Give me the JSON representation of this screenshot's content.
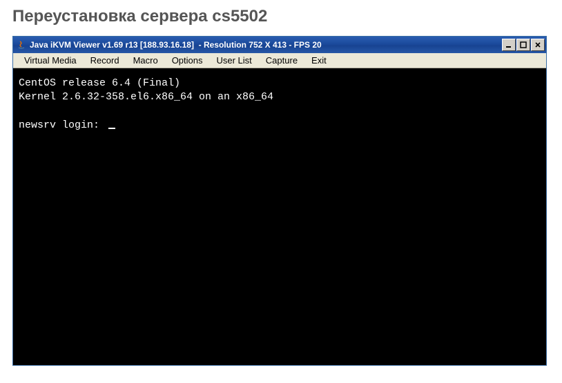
{
  "page": {
    "heading": "Переустановка сервера cs5502"
  },
  "window": {
    "title": "Java iKVM Viewer v1.69 r13 [188.93.16.18]  - Resolution 752 X 413 - FPS 20",
    "controls": {
      "minimize": "_",
      "maximize": "□",
      "close": "✕"
    }
  },
  "menubar": {
    "items": [
      "Virtual Media",
      "Record",
      "Macro",
      "Options",
      "User List",
      "Capture",
      "Exit"
    ]
  },
  "terminal": {
    "line1": "CentOS release 6.4 (Final)",
    "line2": "Kernel 2.6.32-358.el6.x86_64 on an x86_64",
    "line3": "",
    "prompt": "newsrv login: "
  }
}
